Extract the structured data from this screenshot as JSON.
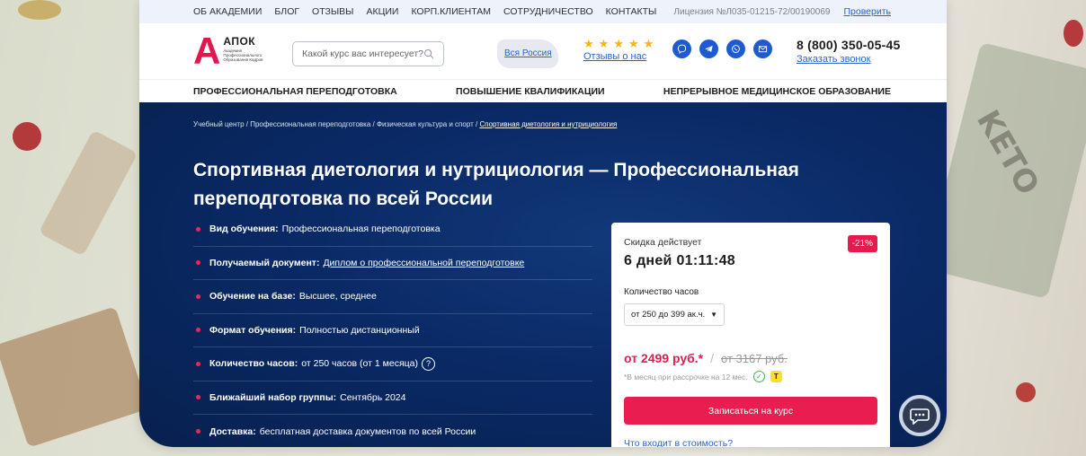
{
  "topbar": {
    "links": [
      "ОБ АКАДЕМИИ",
      "БЛОГ",
      "ОТЗЫВЫ",
      "АКЦИИ",
      "КОРП.КЛИЕНТАМ",
      "СОТРУДНИЧЕСТВО",
      "КОНТАКТЫ"
    ],
    "license": "Лицензия №Л035-01215-72/00190069",
    "check_label": "Проверить"
  },
  "header": {
    "logo_letter": "А",
    "logo_name": "АПОК",
    "logo_sub": "Академия Профессионального Образования Кадров",
    "search_placeholder": "Какой курс вас интересует?",
    "region": "Вся Россия",
    "stars": 5,
    "reviews": "Отзывы о нас",
    "socials": [
      "viber-icon",
      "telegram-icon",
      "whatsapp-icon",
      "mail-icon"
    ],
    "phone": "8 (800) 350-05-45",
    "callback": "Заказать звонок"
  },
  "nav": {
    "items": [
      "ПРОФЕССИОНАЛЬНАЯ ПЕРЕПОДГОТОВКА",
      "ПОВЫШЕНИЕ КВАЛИФИКАЦИИ",
      "НЕПРЕРЫВНОЕ МЕДИЦИНСКОЕ ОБРАЗОВАНИЕ"
    ]
  },
  "breadcrumbs": {
    "items": [
      "Учебный центр",
      "Профессиональная переподготовка",
      "Физическая культура и спорт"
    ],
    "current": "Спортивная диетология и нутрициология"
  },
  "hero": {
    "title": "Спортивная диетология и нутрициология — Профессиональная переподготовка по всей России",
    "facts": [
      {
        "label": "Вид обучения:",
        "value": "Профессиональная переподготовка"
      },
      {
        "label": "Получаемый документ:",
        "value": "Диплом о профессиональной переподготовке"
      },
      {
        "label": "Обучение на базе:",
        "value": "Высшее, среднее"
      },
      {
        "label": "Формат обучения:",
        "value": "Полностью дистанционный"
      },
      {
        "label": "Количество часов:",
        "value": "от 250 часов (от 1 месяца)"
      },
      {
        "label": "Ближайший набор группы:",
        "value": "Сентябрь 2024"
      },
      {
        "label": "Доставка:",
        "value": "бесплатная доставка документов по всей России"
      }
    ]
  },
  "card": {
    "discount_label": "Скидка действует",
    "timer": "6 дней 01:11:48",
    "badge": "-21%",
    "hours_label": "Количество часов",
    "hours_selected": "от 250 до 399 ак.ч.",
    "price": "от 2499 руб.*",
    "separator": "/",
    "old_price": "от 3167 руб.",
    "note": "*В месяц при рассрочке на 12 мес.",
    "cta": "Записаться на курс",
    "whatin": "Что входит в стоимость?"
  },
  "colors": {
    "accent": "#e8194f",
    "link": "#2a63c9",
    "hero_bg": "#0a2a66",
    "star": "#f5b50a"
  }
}
